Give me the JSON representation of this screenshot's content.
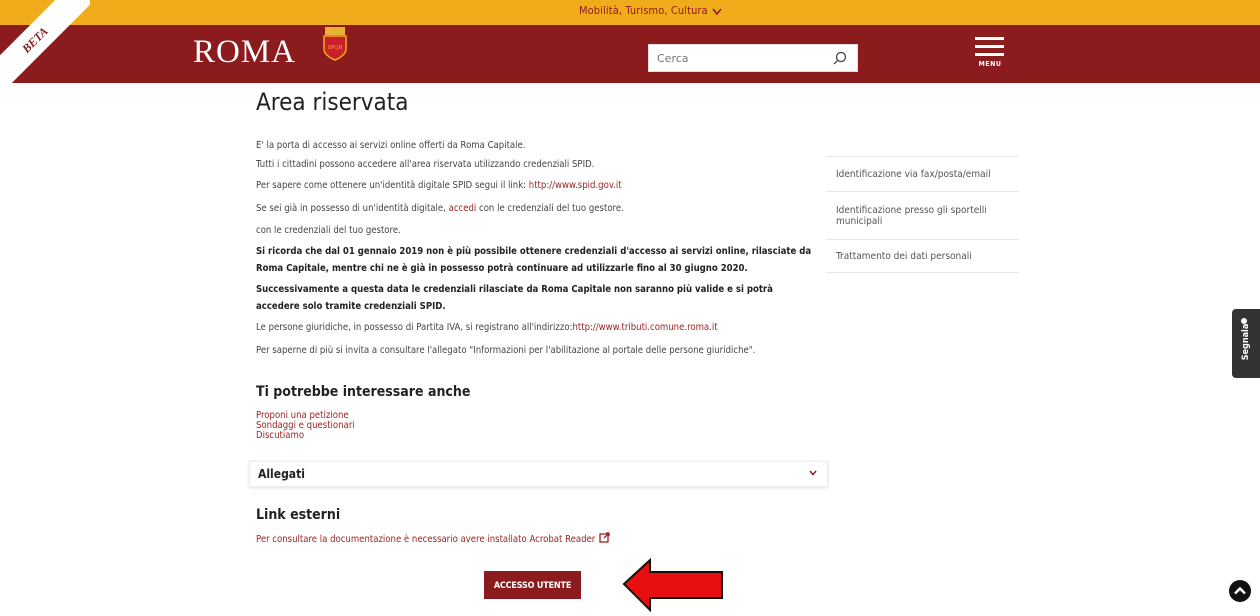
{
  "topbar": {
    "menu_label": "Mobilità, Turismo, Cultura"
  },
  "header": {
    "beta_label": "BETA",
    "logo_text": "ROMA",
    "search_placeholder": "Cerca",
    "menu_label": "MENU"
  },
  "page": {
    "title": "Area riservata",
    "p1": "E' la porta di accesso ai servizi online offerti da Roma Capitale.",
    "p2": "Tutti i cittadini possono accedere all'area riservata utilizzando credenziali SPID.",
    "p3_text": "Per sapere come ottenere un'identità digitale SPID segui il link: ",
    "p3_link": "http://www.spid.gov.it",
    "p4_pre": "Se sei già in possesso di un'identità digitale, ",
    "p4_link": "accedi",
    "p4_post": " con le credenziali del tuo gestore.",
    "p5": "con le credenziali del tuo gestore.",
    "bold1": "Si ricorda che dal 01 gennaio 2019 non è più possibile ottenere credenziali d'accesso ai servizi online, rilasciate da Roma Capitale, mentre chi ne è già in possesso potrà continuare ad utilizzarle fino al 30 giugno 2020.",
    "bold2": "Successivamente a questa data le credenziali rilasciate da Roma Capitale non saranno più valide e si potrà accedere solo tramite credenziali SPID.",
    "p6_text": "Le persone giuridiche, in possesso di Partita IVA, si registrano all'indirizzo:",
    "p6_link": "http://www.tributi.comune.roma.it",
    "p7": "Per saperne di più si invita a consultare l'allegato \"Informazioni per l'abilitazione al portale delle persone giuridiche\"."
  },
  "sidebar": {
    "items": [
      {
        "label": "Identificazione via fax/posta/email"
      },
      {
        "label": "Identificazione presso gli sportelli municipali"
      },
      {
        "label": "Trattamento dei dati personali"
      }
    ]
  },
  "related": {
    "heading": "Ti potrebbe interessare anche",
    "links": [
      {
        "label": "Proponi una petizione"
      },
      {
        "label": "Sondaggi e questionari"
      },
      {
        "label": "Discutiamo"
      }
    ]
  },
  "attachments": {
    "label": "Allegati"
  },
  "external": {
    "heading": "Link esterni",
    "link": "Per consultare la documentazione è necessario avere installato Acrobat Reader"
  },
  "access_button": {
    "label": "ACCESSO UTENTE"
  },
  "feedback": {
    "label": "Segnala"
  },
  "colors": {
    "brand_red": "#8c1b1e",
    "top_orange": "#f1ac1b",
    "link_red": "#9b2323",
    "annotation_arrow": "#e8100f"
  }
}
